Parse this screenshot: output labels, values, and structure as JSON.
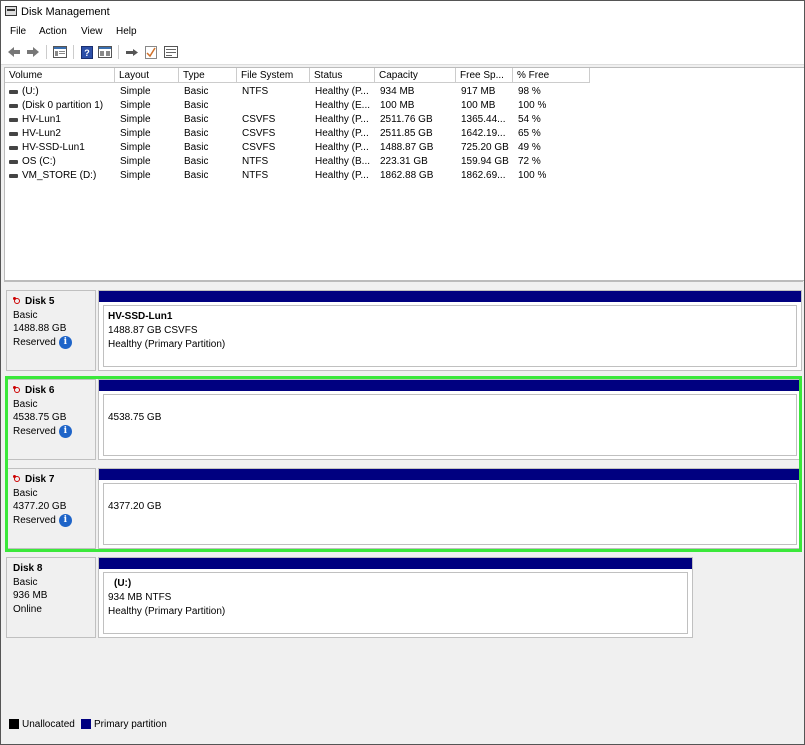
{
  "window": {
    "title": "Disk Management"
  },
  "menu": [
    "File",
    "Action",
    "View",
    "Help"
  ],
  "volume_table": {
    "columns": [
      "Volume",
      "Layout",
      "Type",
      "File System",
      "Status",
      "Capacity",
      "Free Sp...",
      "% Free"
    ],
    "rows": [
      [
        "(U:)",
        "Simple",
        "Basic",
        "NTFS",
        "Healthy (P...",
        "934 MB",
        "917 MB",
        "98 %"
      ],
      [
        "(Disk 0 partition 1)",
        "Simple",
        "Basic",
        "",
        "Healthy (E...",
        "100 MB",
        "100 MB",
        "100 %"
      ],
      [
        "HV-Lun1",
        "Simple",
        "Basic",
        "CSVFS",
        "Healthy (P...",
        "2511.76 GB",
        "1365.44...",
        "54 %"
      ],
      [
        "HV-Lun2",
        "Simple",
        "Basic",
        "CSVFS",
        "Healthy (P...",
        "2511.85 GB",
        "1642.19...",
        "65 %"
      ],
      [
        "HV-SSD-Lun1",
        "Simple",
        "Basic",
        "CSVFS",
        "Healthy (P...",
        "1488.87 GB",
        "725.20 GB",
        "49 %"
      ],
      [
        "OS (C:)",
        "Simple",
        "Basic",
        "NTFS",
        "Healthy (B...",
        "223.31 GB",
        "159.94 GB",
        "72 %"
      ],
      [
        "VM_STORE (D:)",
        "Simple",
        "Basic",
        "NTFS",
        "Healthy (P...",
        "1862.88 GB",
        "1862.69...",
        "100 %"
      ]
    ]
  },
  "disks": [
    {
      "name": "Disk 5",
      "type": "Basic",
      "size": "1488.88 GB",
      "state": "Reserved",
      "has_info": true,
      "partition": {
        "name": "HV-SSD-Lun1",
        "detail": "1488.87 GB CSVFS",
        "status": "Healthy (Primary Partition)"
      }
    },
    {
      "name": "Disk 6",
      "type": "Basic",
      "size": "4538.75 GB",
      "state": "Reserved",
      "has_info": true,
      "partition": {
        "name": "",
        "detail": "4538.75 GB",
        "status": ""
      }
    },
    {
      "name": "Disk 7",
      "type": "Basic",
      "size": "4377.20 GB",
      "state": "Reserved",
      "has_info": true,
      "partition": {
        "name": "",
        "detail": "4377.20 GB",
        "status": ""
      }
    },
    {
      "name": "Disk 8",
      "type": "Basic",
      "size": "936 MB",
      "state": "Online",
      "has_info": false,
      "partition": {
        "name": "(U:)",
        "detail": "934 MB NTFS",
        "status": "Healthy (Primary Partition)"
      }
    }
  ],
  "legend": {
    "unallocated": {
      "label": "Unallocated",
      "color": "#000000"
    },
    "primary": {
      "label": "Primary partition",
      "color": "#000080"
    }
  },
  "colors": {
    "highlight": "#3ae83a",
    "partition_bar": "#000080",
    "info_icon": "#1e64c8"
  },
  "toolbar_icons": [
    "back-arrow-icon",
    "forward-arrow-icon",
    "console-tree-icon",
    "help-icon",
    "properties-icon",
    "connect-icon",
    "check-icon",
    "rescan-icon"
  ]
}
